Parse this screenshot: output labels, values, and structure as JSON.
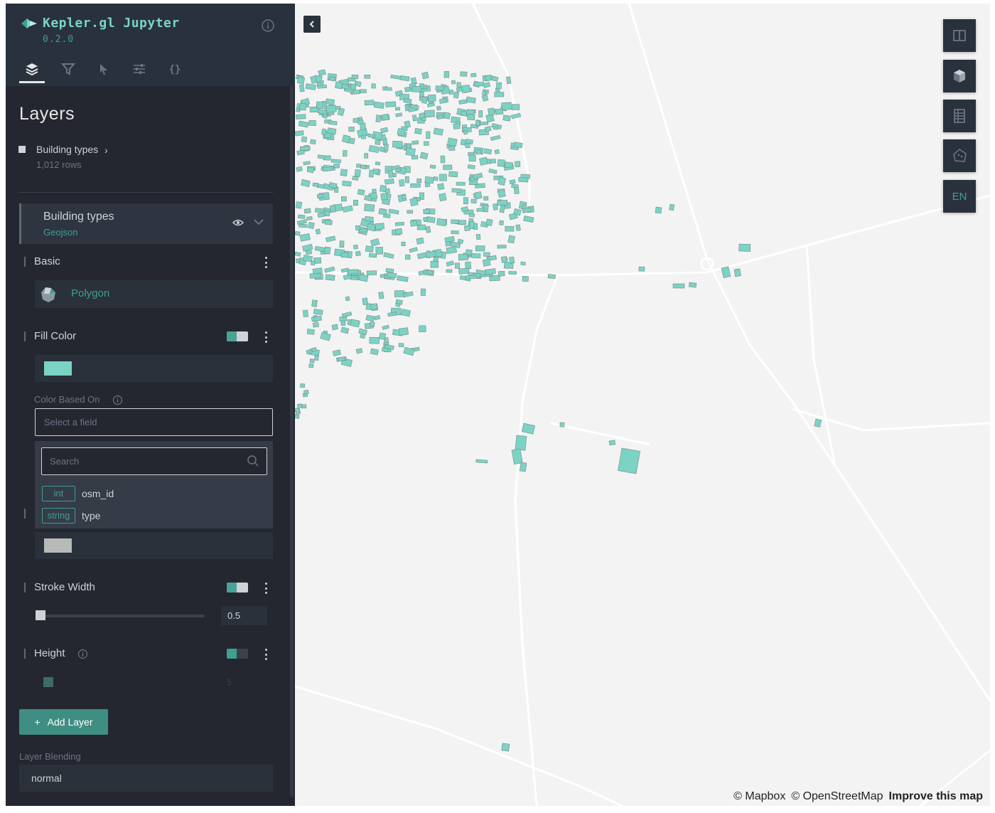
{
  "app": {
    "title": "Kepler.gl Jupyter",
    "version": "0.2.0"
  },
  "tabs": [
    {
      "name": "layers",
      "icon": "layers-icon",
      "active": true
    },
    {
      "name": "filters",
      "icon": "filter-icon"
    },
    {
      "name": "interactions",
      "icon": "cursor-icon"
    },
    {
      "name": "base-map",
      "icon": "sliders-icon"
    },
    {
      "name": "config",
      "icon": "braces-icon"
    }
  ],
  "panel": {
    "section_title": "Layers",
    "dataset": {
      "name": "Building types",
      "rows": "1,012 rows"
    },
    "layer": {
      "name": "Building types",
      "type": "Geojson",
      "basic_label": "Basic",
      "layer_type": "Polygon",
      "fill_color_label": "Fill Color",
      "fill_color": "#7ad3c4",
      "color_based_on_label": "Color Based On",
      "color_field_placeholder": "Select a field",
      "search_placeholder": "Search",
      "fields": [
        {
          "type": "int",
          "name": "osm_id"
        },
        {
          "type": "string",
          "name": "type"
        }
      ],
      "stroke_color": "#b8bab7",
      "stroke_width_label": "Stroke Width",
      "stroke_width_value": "0.5",
      "height_label": "Height",
      "height_value": "5"
    },
    "add_layer_label": "Add Layer",
    "layer_blending_label": "Layer Blending",
    "layer_blending_value": "normal"
  },
  "map": {
    "controls": [
      {
        "name": "split-map",
        "icon": "split-map-icon"
      },
      {
        "name": "3d-view",
        "icon": "cube-icon"
      },
      {
        "name": "legend",
        "icon": "legend-icon"
      },
      {
        "name": "draw",
        "icon": "polygon-draw-icon"
      },
      {
        "name": "language",
        "label": "EN"
      }
    ],
    "building_color": "#7ad3c4",
    "attribution": {
      "mapbox": "© Mapbox",
      "osm": "© OpenStreetMap",
      "improve": "Improve this map"
    }
  },
  "colors": {
    "panel_bg": "#242730",
    "header_bg": "#29323c",
    "accent": "#3f9f93",
    "map_bg": "#f3f3f3"
  }
}
